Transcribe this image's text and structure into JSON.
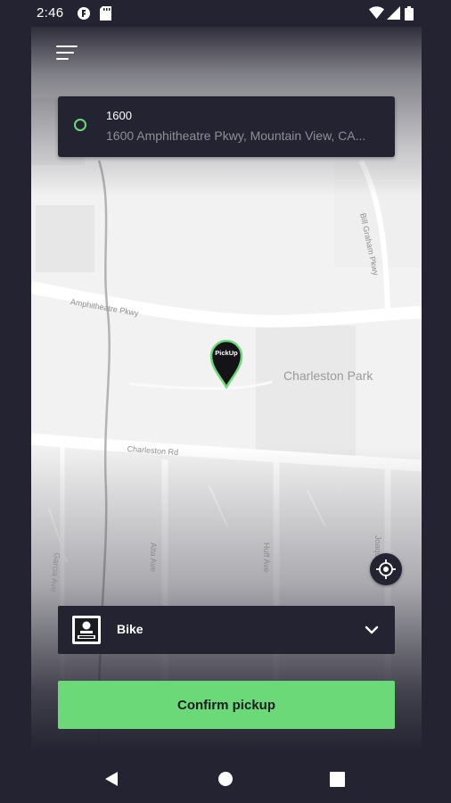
{
  "status_bar": {
    "time": "2:46",
    "icons": [
      "app-notification-icon",
      "sd-card-icon",
      "wifi-icon",
      "signal-icon",
      "battery-icon"
    ]
  },
  "header": {
    "menu_icon": "menu-icon"
  },
  "pickup_address": {
    "title": "1600",
    "subtitle": "1600 Amphitheatre Pkwy, Mountain View, CA..."
  },
  "map": {
    "streets": [
      "Amphitheatre Pkwy",
      "Charleston Rd",
      "Bill Graham Pkwy",
      "Alta Ave",
      "Huff Ave",
      "Joaquin Rd",
      "Garcia Ave"
    ],
    "park": "Charleston Park",
    "pin_label": "PickUp"
  },
  "vehicle": {
    "label": "Bike",
    "icon": "bike-icon",
    "dropdown_icon": "chevron-down-icon"
  },
  "confirm_button": {
    "label": "Confirm pickup"
  },
  "colors": {
    "accent": "#6cd979",
    "panel": "#242331",
    "map_bg": "#f2f2f2"
  },
  "nav_bar": {
    "back": "back-icon",
    "home": "home-icon",
    "recents": "recents-icon"
  }
}
